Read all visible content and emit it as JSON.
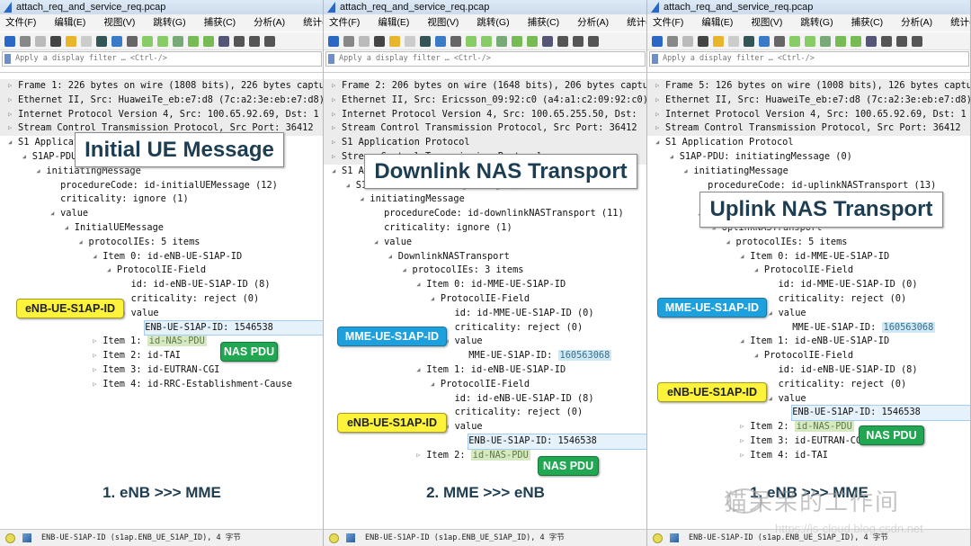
{
  "app": {
    "title": "attach_req_and_service_req.pcap",
    "menu": [
      "文件(F)",
      "编辑(E)",
      "视图(V)",
      "跳转(G)",
      "捕获(C)",
      "分析(A)",
      "统计(S)",
      "电话(Y)"
    ],
    "filter_placeholder": "Apply a display filter … <Ctrl-/>",
    "status_text": "ENB-UE-S1AP-ID (s1ap.ENB_UE_S1AP_ID), 4 字节"
  },
  "panels": [
    {
      "title": "Initial UE Message",
      "caption": "1. eNB >>> MME",
      "lines": [
        {
          "t": "Frame 1: 226 bytes on wire (1808 bits), 226 bytes captured",
          "d": 0,
          "g": "c",
          "h": 1
        },
        {
          "t": "Ethernet II, Src: HuaweiTe_eb:e7:d8 (7c:a2:3e:eb:e7:d8)",
          "d": 0,
          "g": "c",
          "h": 1
        },
        {
          "t": "Internet Protocol Version 4, Src: 100.65.92.69, Dst: 1",
          "d": 0,
          "g": "c",
          "h": 1
        },
        {
          "t": "Stream Control Transmission Protocol, Src Port: 36412",
          "d": 0,
          "g": "c",
          "h": 1
        },
        {
          "t": "S1 Application Protocol",
          "d": 0,
          "g": "e"
        },
        {
          "t": "S1AP-PDU: initiatingMessage (0)",
          "d": 1,
          "g": "e"
        },
        {
          "t": "initiatingMessage",
          "d": 2,
          "g": "e"
        },
        {
          "t": "procedureCode: id-initialUEMessage (12)",
          "d": 3
        },
        {
          "t": "criticality: ignore (1)",
          "d": 3
        },
        {
          "t": "value",
          "d": 3,
          "g": "e"
        },
        {
          "t": "InitialUEMessage",
          "d": 4,
          "g": "e"
        },
        {
          "t": "protocolIEs: 5 items",
          "d": 5,
          "g": "e"
        },
        {
          "t": "Item 0: id-eNB-UE-S1AP-ID",
          "d": 6,
          "g": "e"
        },
        {
          "t": "ProtocolIE-Field",
          "d": 7,
          "g": "e"
        },
        {
          "t": "id: id-eNB-UE-S1AP-ID (8)",
          "d": 8
        },
        {
          "t": "criticality: reject (0)",
          "d": 8
        },
        {
          "t": "value",
          "d": 8,
          "g": "e"
        },
        {
          "t": "ENB-UE-S1AP-ID: 1546538",
          "d": 9,
          "s": 1
        },
        {
          "t": "Item 1: ",
          "m": "id-NAS-PDU",
          "mc": "green",
          "d": 6,
          "g": "c"
        },
        {
          "t": "Item 2: id-TAI",
          "d": 6,
          "g": "c"
        },
        {
          "t": "Item 3: id-EUTRAN-CGI",
          "d": 6,
          "g": "c"
        },
        {
          "t": "Item 4: id-RRC-Establishment-Cause",
          "d": 6,
          "g": "c"
        }
      ],
      "callouts": [
        {
          "label": "eNB-UE-S1AP-ID",
          "color": "#fcf33a"
        },
        {
          "label": "NAS PDU",
          "color": "#21a652"
        }
      ]
    },
    {
      "title": "Downlink NAS Transport",
      "caption": "2. MME >>> eNB",
      "lines": [
        {
          "t": "Frame 2: 206 bytes on wire (1648 bits), 206 bytes captured",
          "d": 0,
          "g": "c",
          "h": 1
        },
        {
          "t": "Ethernet II, Src: Ericsson_09:92:c0 (a4:a1:c2:09:92:c0)",
          "d": 0,
          "g": "c",
          "h": 1
        },
        {
          "t": "Internet Protocol Version 4, Src: 100.65.255.50, Dst: ",
          "d": 0,
          "g": "c",
          "h": 1
        },
        {
          "t": "Stream Control Transmission Protocol, Src Port: 36412",
          "d": 0,
          "g": "c",
          "h": 1
        },
        {
          "t": "S1 Application Protocol",
          "d": 0,
          "g": "c",
          "h": 1
        },
        {
          "t": "Stream Control Transmission Protocol",
          "d": 0,
          "g": "c",
          "h": 1
        },
        {
          "t": "S1 Application Protocol",
          "d": 0,
          "g": "e"
        },
        {
          "t": "S1AP-PDU: initiatingMessage (0)",
          "d": 1,
          "g": "e"
        },
        {
          "t": "initiatingMessage",
          "d": 2,
          "g": "e"
        },
        {
          "t": "procedureCode: id-downlinkNASTransport (11)",
          "d": 3
        },
        {
          "t": "criticality: ignore (1)",
          "d": 3
        },
        {
          "t": "value",
          "d": 3,
          "g": "e"
        },
        {
          "t": "DownlinkNASTransport",
          "d": 4,
          "g": "e"
        },
        {
          "t": "protocolIEs: 3 items",
          "d": 5,
          "g": "e"
        },
        {
          "t": "Item 0: id-MME-UE-S1AP-ID",
          "d": 6,
          "g": "e"
        },
        {
          "t": "ProtocolIE-Field",
          "d": 7,
          "g": "e"
        },
        {
          "t": "id: id-MME-UE-S1AP-ID (0)",
          "d": 8
        },
        {
          "t": "criticality: reject (0)",
          "d": 8
        },
        {
          "t": "value",
          "d": 8,
          "g": "e"
        },
        {
          "t": "MME-UE-S1AP-ID: ",
          "m": "160563068",
          "mc": "blue",
          "d": 9
        },
        {
          "t": "Item 1: id-eNB-UE-S1AP-ID",
          "d": 6,
          "g": "e"
        },
        {
          "t": "ProtocolIE-Field",
          "d": 7,
          "g": "e"
        },
        {
          "t": "id: id-eNB-UE-S1AP-ID (8)",
          "d": 8
        },
        {
          "t": "criticality: reject (0)",
          "d": 8
        },
        {
          "t": "value",
          "d": 8,
          "g": "e"
        },
        {
          "t": "ENB-UE-S1AP-ID: 1546538",
          "d": 9,
          "s": 1
        },
        {
          "t": "Item 2: ",
          "m": "id-NAS-PDU",
          "mc": "green",
          "d": 6,
          "g": "c"
        }
      ],
      "callouts": [
        {
          "label": "MME-UE-S1AP-ID",
          "color": "#1ea0dc"
        },
        {
          "label": "eNB-UE-S1AP-ID",
          "color": "#fcf33a"
        },
        {
          "label": "NAS PDU",
          "color": "#21a652"
        }
      ]
    },
    {
      "title": "Uplink NAS Transport",
      "caption": "1. eNB >>> MME",
      "lines": [
        {
          "t": "Frame 5: 126 bytes on wire (1008 bits), 126 bytes captured",
          "d": 0,
          "g": "c",
          "h": 1
        },
        {
          "t": "Ethernet II, Src: HuaweiTe_eb:e7:d8 (7c:a2:3e:eb:e7:d8)",
          "d": 0,
          "g": "c",
          "h": 1
        },
        {
          "t": "Internet Protocol Version 4, Src: 100.65.92.69, Dst: 1",
          "d": 0,
          "g": "c",
          "h": 1
        },
        {
          "t": "Stream Control Transmission Protocol, Src Port: 36412",
          "d": 0,
          "g": "c",
          "h": 1
        },
        {
          "t": "S1 Application Protocol",
          "d": 0,
          "g": "e"
        },
        {
          "t": "S1AP-PDU: initiatingMessage (0)",
          "d": 1,
          "g": "e"
        },
        {
          "t": "initiatingMessage",
          "d": 2,
          "g": "e"
        },
        {
          "t": "procedureCode: id-uplinkNASTransport (13)",
          "d": 3
        },
        {
          "t": "criticality: ignore (1)",
          "d": 3
        },
        {
          "t": "value",
          "d": 3,
          "g": "e"
        },
        {
          "t": "UplinkNASTransport",
          "d": 4,
          "g": "e"
        },
        {
          "t": "protocolIEs: 5 items",
          "d": 5,
          "g": "e"
        },
        {
          "t": "Item 0: id-MME-UE-S1AP-ID",
          "d": 6,
          "g": "e"
        },
        {
          "t": "ProtocolIE-Field",
          "d": 7,
          "g": "e"
        },
        {
          "t": "id: id-MME-UE-S1AP-ID (0)",
          "d": 8
        },
        {
          "t": "criticality: reject (0)",
          "d": 8
        },
        {
          "t": "value",
          "d": 8,
          "g": "e"
        },
        {
          "t": "MME-UE-S1AP-ID: ",
          "m": "160563068",
          "mc": "blue",
          "d": 9
        },
        {
          "t": "Item 1: id-eNB-UE-S1AP-ID",
          "d": 6,
          "g": "e"
        },
        {
          "t": "ProtocolIE-Field",
          "d": 7,
          "g": "e"
        },
        {
          "t": "id: id-eNB-UE-S1AP-ID (8)",
          "d": 8
        },
        {
          "t": "criticality: reject (0)",
          "d": 8
        },
        {
          "t": "value",
          "d": 8,
          "g": "e"
        },
        {
          "t": "ENB-UE-S1AP-ID: 1546538",
          "d": 9,
          "s": 1
        },
        {
          "t": "Item 2: ",
          "m": "id-NAS-PDU",
          "mc": "green",
          "d": 6,
          "g": "c"
        },
        {
          "t": "Item 3: id-EUTRAN-CGI",
          "d": 6,
          "g": "c"
        },
        {
          "t": "Item 4: id-TAI",
          "d": 6,
          "g": "c"
        }
      ],
      "callouts": [
        {
          "label": "MME-UE-S1AP-ID",
          "color": "#1ea0dc"
        },
        {
          "label": "eNB-UE-S1AP-ID",
          "color": "#fcf33a"
        },
        {
          "label": "NAS PDU",
          "color": "#21a652"
        }
      ]
    }
  ],
  "watermark": {
    "text": "猫呆呆的工作间",
    "url": "https://js-cloud.blog.csdn.net"
  }
}
